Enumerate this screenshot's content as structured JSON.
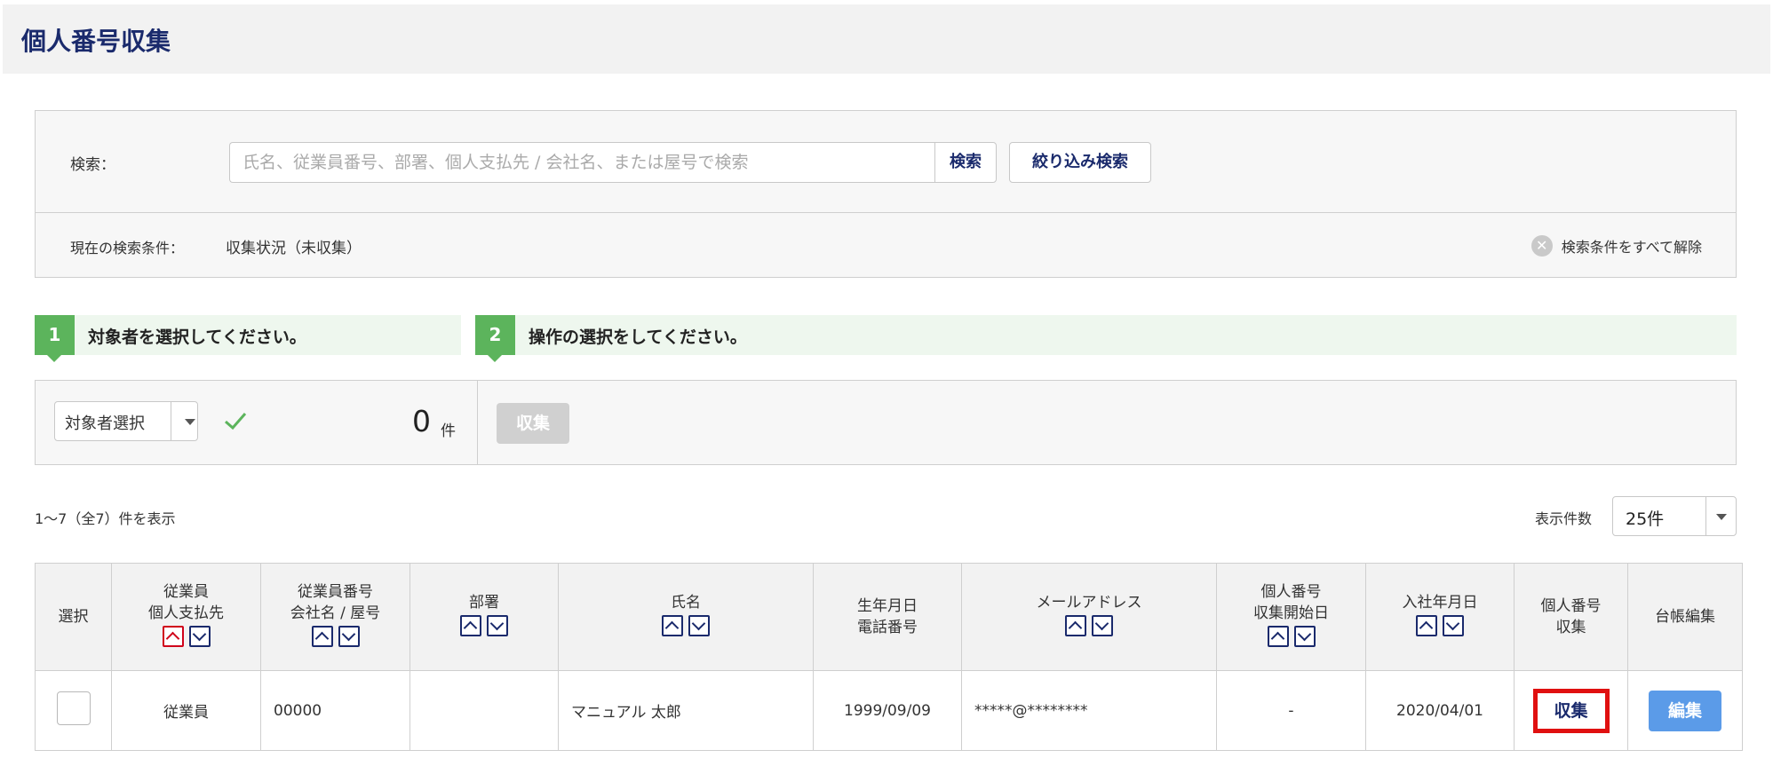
{
  "page": {
    "title": "個人番号収集"
  },
  "search": {
    "label": "検索：",
    "placeholder": "氏名、従業員番号、部署、個人支払先 / 会社名、または屋号で検索",
    "button": "検索",
    "filter_button": "絞り込み検索",
    "current_label": "現在の検索条件：",
    "current_value": "収集状況（未収集）",
    "clear_all": "検索条件をすべて解除"
  },
  "steps": [
    {
      "number": "1",
      "text": "対象者を選択してください。"
    },
    {
      "number": "2",
      "text": "操作の選択をしてください。"
    }
  ],
  "action": {
    "select_label": "対象者選択",
    "count": "0",
    "count_unit": "件",
    "collect_label": "収集"
  },
  "list": {
    "range_text": "1〜7（全7）件を表示",
    "per_page_label": "表示件数",
    "per_page_value": "25件"
  },
  "table": {
    "headers": [
      {
        "line1": "選択",
        "line2": ""
      },
      {
        "line1": "従業員",
        "line2": "個人支払先"
      },
      {
        "line1": "従業員番号",
        "line2": "会社名 / 屋号"
      },
      {
        "line1": "部署",
        "line2": ""
      },
      {
        "line1": "氏名",
        "line2": ""
      },
      {
        "line1": "生年月日",
        "line2": "電話番号"
      },
      {
        "line1": "メールアドレス",
        "line2": ""
      },
      {
        "line1": "個人番号",
        "line2": "収集開始日"
      },
      {
        "line1": "入社年月日",
        "line2": ""
      },
      {
        "line1": "個人番号",
        "line2": "収集"
      },
      {
        "line1": "台帳編集",
        "line2": ""
      }
    ],
    "rows": [
      {
        "type": "従業員",
        "number": "00000",
        "department": "",
        "name": "マニュアル 太郎",
        "birthdate": "1999/09/09",
        "email": "*****@********",
        "collect_start": "-",
        "hire_date": "2020/04/01",
        "collect_label": "収集",
        "edit_label": "編集"
      }
    ]
  },
  "colors": {
    "accent_navy": "#1a2a6c",
    "step_green": "#5cb45c",
    "highlight_red": "#e01010",
    "edit_blue": "#5b9be8"
  }
}
